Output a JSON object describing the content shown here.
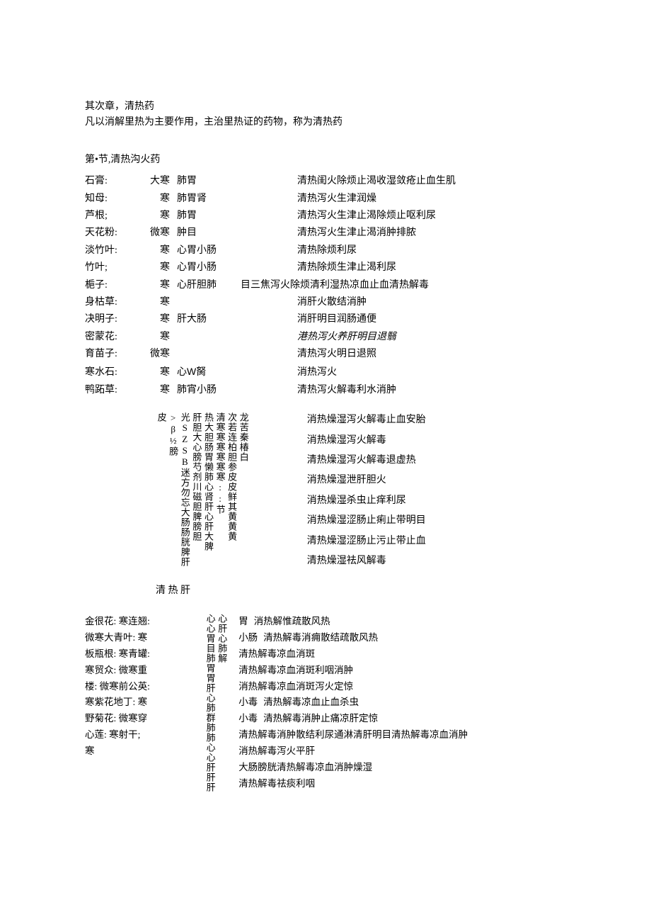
{
  "intro": {
    "l1": "其次章，清热药",
    "l2": "凡以消解里热为主要作用，主治里热证的药物，称为清热药"
  },
  "section1": {
    "title": "第•节,清热沟火药",
    "rows": [
      {
        "name": "石膏:",
        "temp": "大寒",
        "meridian": "肺胃",
        "mid": "",
        "effect": "清热闺火除烦止渴收湿敛疮止血生肌"
      },
      {
        "name": "知母:",
        "temp": "寒",
        "meridian": "肺胃肾",
        "mid": "",
        "effect": "清热泻火生津润燥"
      },
      {
        "name": "芦根;",
        "temp": "寒",
        "meridian": "肺胃",
        "mid": "",
        "effect": "清热泻火生津止渴除烦止呕利尿"
      },
      {
        "name": "天花粉:",
        "temp": "微寒",
        "meridian": "肿目",
        "mid": "",
        "effect": "清热泻火生津止渴消肿排脓"
      },
      {
        "name": "淡竹叶:",
        "temp": "寒",
        "meridian": "心胃小肠",
        "mid": "",
        "effect": "清热除烦利尿"
      },
      {
        "name": "竹叶;",
        "temp": "寒",
        "meridian": "心胃小肠",
        "mid": "",
        "effect": "清热除烦生津止渴利尿"
      },
      {
        "name": "梔子:",
        "temp": "寒",
        "meridian": "心肝胆肺",
        "mid": "目三焦泻火除烦清利湿热凉血止血清热解毒",
        "effect": ""
      },
      {
        "name": "身枯草:",
        "temp": "寒",
        "meridian": "",
        "mid": "",
        "effect": "消肝火散结消肿"
      },
      {
        "name": "决明子:",
        "temp": "寒",
        "meridian": "肝大肠",
        "mid": "",
        "effect": "消肝明目润肠通便"
      },
      {
        "name": "密蒙花:",
        "temp": "寒",
        "meridian": "",
        "mid": "",
        "effect": "港热泻火养肝明目退翳",
        "italic": true
      },
      {
        "name": "育苗子:",
        "temp": "微寒",
        "meridian": "",
        "mid": "",
        "effect": "清热泻火明日退照"
      },
      {
        "name": "寒水石:",
        "temp": "寒",
        "meridian": "心W胬",
        "mid": "",
        "effect": "消热泻火",
        "special": true
      },
      {
        "name": "鸭跖草:",
        "temp": "寒",
        "meridian": "肺宵小肠",
        "mid": "",
        "effect": "清热泻火解毒利水消肿"
      }
    ]
  },
  "section2": {
    "vcols_ltr": [
      "龙苦秦椿白",
      "次若连柏胆参皮皮鲜其黄黄黄",
      "清寒寒寒寒寒寒::节",
      "热大胆肠胃懒肺心肾肝心肝大脾",
      "肝胆大心膀芍剂川磁胆脾膀胆",
      "光SZSB迷方勿忘大肠肠胱脾肝",
      ">β½膀",
      "皮"
    ],
    "right": [
      "消热燥湿泻火解毒止血安胎",
      "消热燥湿泻火解毒",
      "清热燥湿泻火解毒退虚热",
      "消热燥湿泄肝胆火",
      "消热燥湿杀虫止痒利尿",
      "消热燥湿涩肠止痢止带明目",
      "清热燥湿涩肠止污止带止血",
      "清热燥湿祛风解毒"
    ]
  },
  "section3": {
    "header": "清 热 肝",
    "left": [
      "金很花: 寒连翘:",
      "微寒大青叶: 寒",
      "板瓶根: 寒青罐:",
      "寒贸众: 微寒重",
      "楼: 微寒前公英:",
      "寒紫花地丁: 寒",
      "野菊花: 微寒穿",
      "心莲: 寒射干;",
      "寒"
    ],
    "midcols_ltr": [
      "心肝心肺解",
      "心心胃目肺胃胃肝心肺群肺肺心心肝肝肝"
    ],
    "right": [
      {
        "pre": "胃",
        "txt": "消热解惟疏散风热"
      },
      {
        "pre": "小肠",
        "txt": "清热解毒消痈散结疏散风热"
      },
      {
        "pre": "",
        "txt": "清热解毒凉血消斑"
      },
      {
        "pre": "",
        "txt": "清热解毒凉血消斑利咽消肿"
      },
      {
        "pre": "",
        "txt": "消热解毒凉血消斑泻火定惊"
      },
      {
        "pre": "小毒",
        "txt": "清热解毒凉血止血杀虫"
      },
      {
        "pre": "小毒",
        "txt": "清热解毒消肿止痛凉肝定惊"
      },
      {
        "pre": "",
        "txt": "清热解毒消肿散结利尿通淋清肝明目清热解毒凉血消肿"
      },
      {
        "pre": "",
        "txt": "消热解毒泻火平肝"
      },
      {
        "pre": "",
        "txt": "大肠膀胱清热解毒凉血消肿燥湿"
      },
      {
        "pre": "",
        "txt": "清热解毒祛痰利咽"
      }
    ]
  }
}
